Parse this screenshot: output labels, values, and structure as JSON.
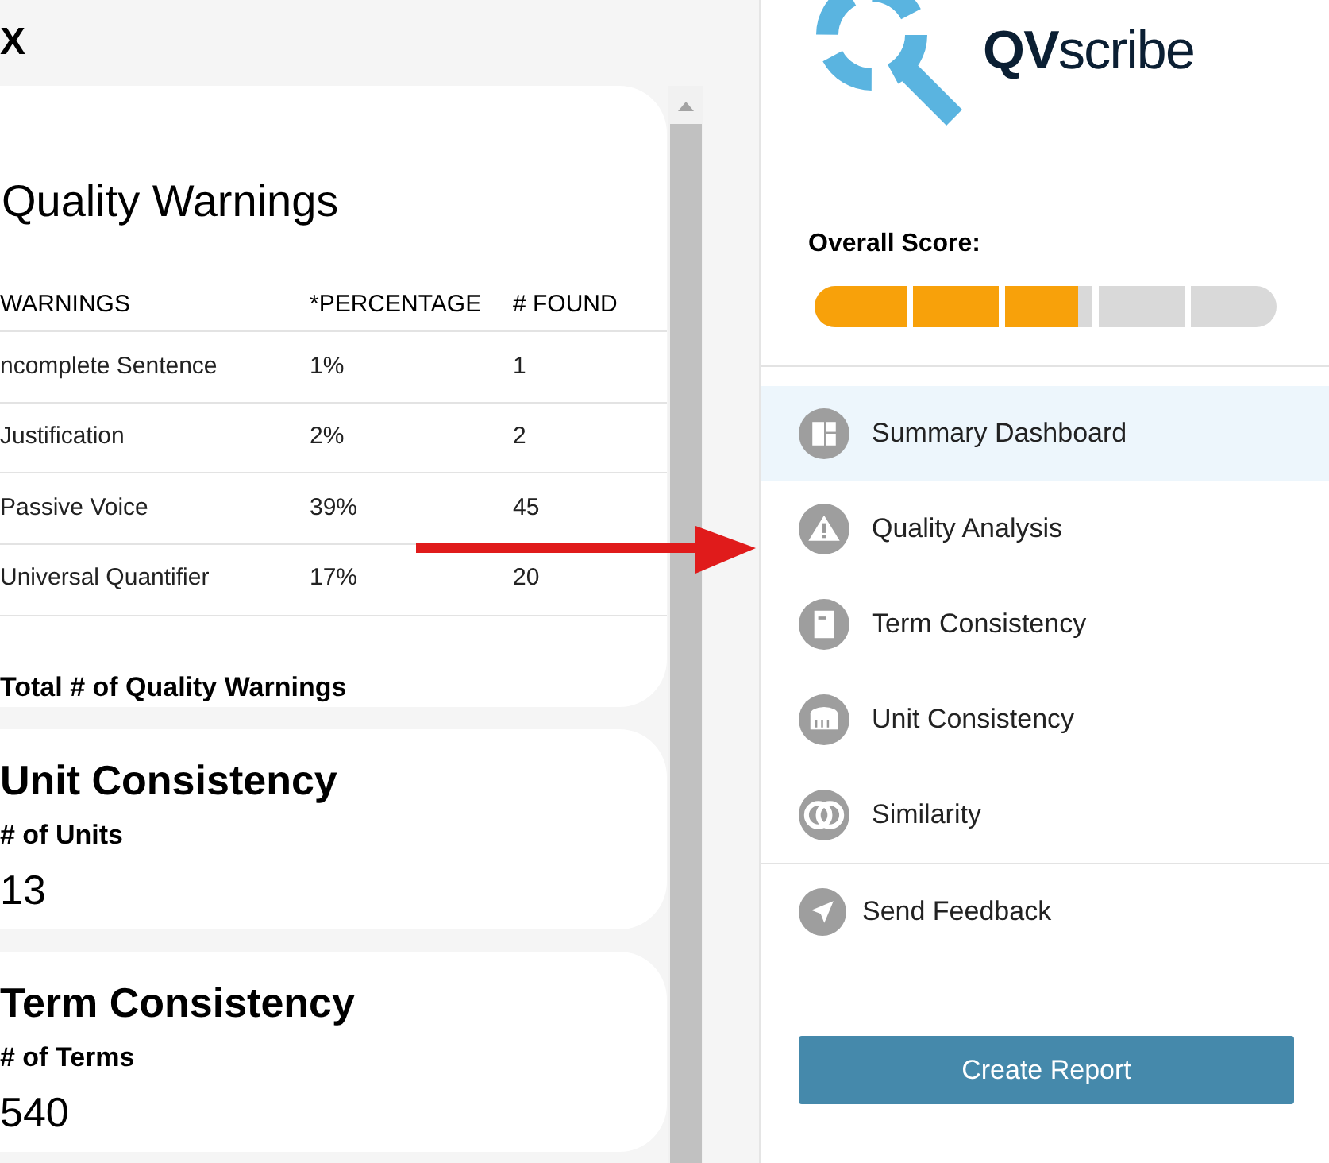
{
  "close_label": "X",
  "quality_warnings": {
    "title": "Quality Warnings",
    "columns": [
      "WARNINGS",
      "*PERCENTAGE",
      "# FOUND"
    ],
    "rows": [
      [
        "ncomplete Sentence",
        "1%",
        "1"
      ],
      [
        "Justification",
        "2%",
        "2"
      ],
      [
        "Passive Voice",
        "39%",
        "45"
      ],
      [
        "Universal Quantifier",
        "17%",
        "20"
      ]
    ],
    "total_label": "Total # of Quality Warnings"
  },
  "cards": [
    {
      "title": "Unit Consistency",
      "label": "# of Units",
      "value": "13"
    },
    {
      "title": "Term Consistency",
      "label": "# of Terms",
      "value": "540"
    }
  ],
  "sidebar": {
    "logo": {
      "bold": "QV",
      "light": "scribe"
    },
    "score_label": "Overall Score:",
    "score": {
      "level": 0.57
    },
    "items": [
      {
        "label": "Summary Dashboard",
        "selected": true
      },
      {
        "label": "Quality Analysis",
        "selected": false
      },
      {
        "label": "Term Consistency",
        "selected": false
      },
      {
        "label": "Unit Consistency",
        "selected": false
      },
      {
        "label": "Similarity",
        "selected": false
      }
    ],
    "feedback": "Send Feedback",
    "button": "Create Report"
  }
}
